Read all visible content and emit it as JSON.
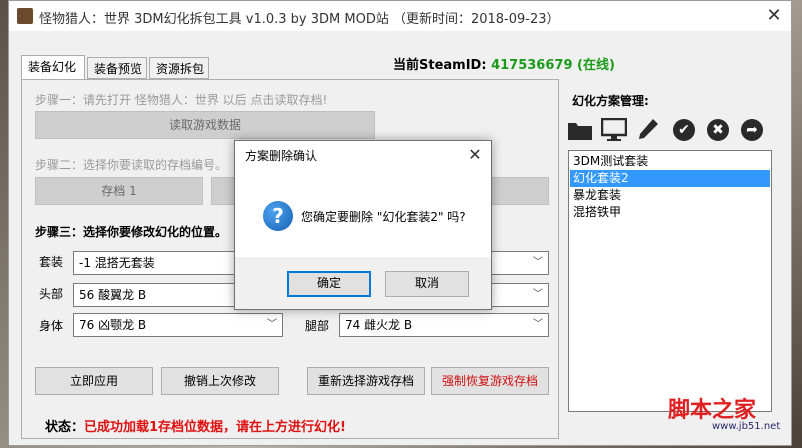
{
  "window": {
    "title": "怪物猎人：世界 3DM幻化拆包工具 v1.0.3 by 3DM MOD站 （更新时间：2018-09-23）",
    "close": "✕"
  },
  "tabs": [
    "装备幻化",
    "装备预览",
    "资源拆包"
  ],
  "steam": {
    "label": "当前SteamID:",
    "id": "417536679",
    "status": "(在线)"
  },
  "steps": {
    "step1": "步骤一：请先打开 怪物猎人：世界 以后 点击读取存档!",
    "read_button": "读取游戏数据",
    "step2": "步骤二：选择你要读取的存档编号。",
    "slot1_button": "存档 1",
    "step3": "步骤三：选择你要修改幻化的位置。"
  },
  "fields": {
    "set_label": "套装",
    "set_value": "-1 混搭无套装",
    "head_label": "头部",
    "head_value": "56 酸翼龙 B",
    "body_label": "身体",
    "body_value": "76 凶颚龙 B",
    "legs_label": "腿部",
    "legs_value": "74 雌火龙 B"
  },
  "buttons": {
    "apply": "立即应用",
    "undo": "撤销上次修改",
    "reselect": "重新选择游戏存档",
    "restore": "强制恢复游戏存档"
  },
  "status": {
    "label": "状态：",
    "message": "已成功加载1存档位数据，请在上方进行幻化!"
  },
  "manager": {
    "title": "幻化方案管理:",
    "items": [
      "3DM测试套装",
      "幻化套装2",
      "暴龙套装",
      "混搭铁甲"
    ],
    "selected": 1,
    "icons": [
      "folder-icon",
      "monitor-icon",
      "pen-icon",
      "check-icon",
      "x-icon",
      "share-icon"
    ]
  },
  "dialog": {
    "title": "方案删除确认",
    "close": "✕",
    "question": "您确定要删除 \"幻化套装2\" 吗?",
    "icon": "?",
    "ok": "确定",
    "cancel": "取消"
  },
  "watermark": {
    "main": "脚本之家",
    "sub": "www.jb51.net"
  },
  "colors": {
    "steam_green": "#1a9b1a",
    "status_red": "#e01010",
    "selection_blue": "#3399ff"
  }
}
